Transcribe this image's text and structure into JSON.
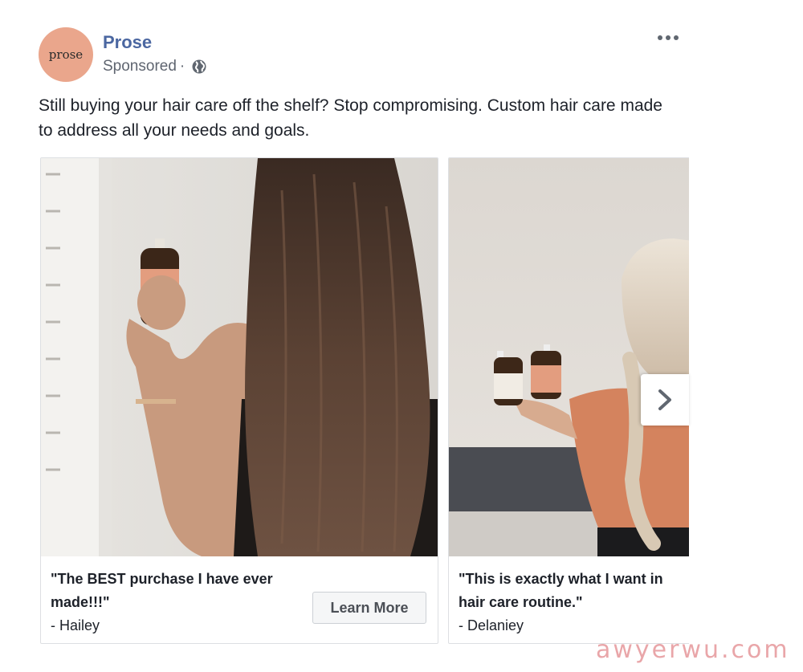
{
  "post": {
    "brand_name": "Prose",
    "avatar_logo_text": "prose",
    "sponsored_label": "Sponsored",
    "separator": "·",
    "text": "Still buying your hair care off the shelf? Stop compromising. Custom hair care made to address all your needs and goals."
  },
  "carousel": {
    "cards": [
      {
        "caption_lines": [
          "\"The BEST purchase I have ever",
          "made!!!\""
        ],
        "author": "- Hailey",
        "cta_label": "Learn More"
      },
      {
        "caption_lines": [
          "\"This is exactly what I want in",
          "hair care routine.\""
        ],
        "author": "- Delaniey"
      }
    ]
  },
  "icons": {
    "avatar": "prose-logo-icon",
    "privacy": "globe-icon",
    "menu": "more-options-icon",
    "next": "chevron-right-icon"
  },
  "colors": {
    "brand_link": "#4b67a1",
    "avatar_bg": "#eaa68c",
    "button_bg": "#f5f6f7"
  },
  "watermark": "awyerwu.com"
}
